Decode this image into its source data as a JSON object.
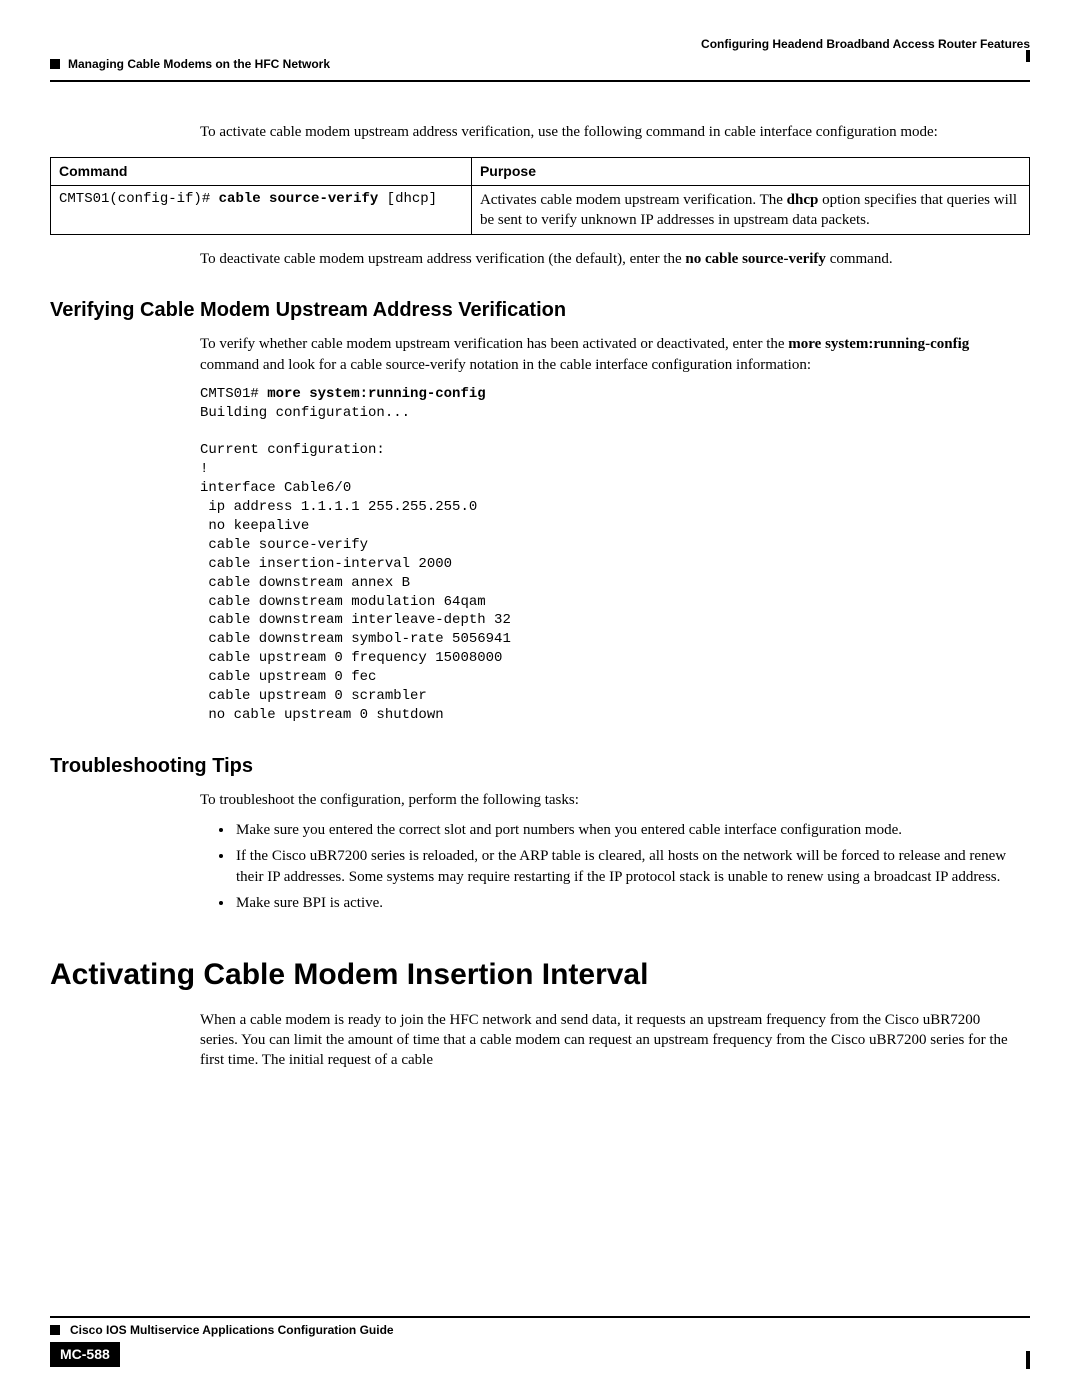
{
  "runningHeadRight": "Configuring Headend Broadband Access Router Features",
  "runningHeadLeft": "Managing Cable Modems on the HFC Network",
  "intro1": "To activate cable modem upstream address verification, use the following command in cable interface configuration mode:",
  "table": {
    "headers": {
      "command": "Command",
      "purpose": "Purpose"
    },
    "row1": {
      "prompt": "CMTS01(config-if)# ",
      "cmd": "cable source-verify ",
      "arg": "[dhcp]",
      "purpose_a": "Activates cable modem upstream verification. The ",
      "purpose_b": "dhcp",
      "purpose_c": " option specifies that queries will be sent to verify unknown IP addresses in upstream data packets."
    }
  },
  "intro2_a": "To deactivate cable modem upstream address verification (the default), enter the ",
  "intro2_b": "no cable source-verify",
  "intro2_c": " command.",
  "h2_verify": "Verifying Cable Modem Upstream Address Verification",
  "verify_a": "To verify whether cable modem upstream verification has been activated or deactivated, enter the  ",
  "verify_b": "more system:running-config",
  "verify_c": " command and look for a cable source-verify notation in the cable interface configuration information:",
  "code_prompt": "CMTS01# ",
  "code_cmd": "more system:running-config",
  "code_body": "Building configuration...\n\nCurrent configuration:\n!\ninterface Cable6/0\n ip address 1.1.1.1 255.255.255.0\n no keepalive\n cable source-verify\n cable insertion-interval 2000\n cable downstream annex B\n cable downstream modulation 64qam\n cable downstream interleave-depth 32\n cable downstream symbol-rate 5056941\n cable upstream 0 frequency 15008000\n cable upstream 0 fec\n cable upstream 0 scrambler\n no cable upstream 0 shutdown",
  "h2_trouble": "Troubleshooting Tips",
  "trouble_intro": "To troubleshoot the configuration, perform the following tasks:",
  "trouble_items": [
    "Make sure you entered the correct slot and port numbers when you entered cable interface configuration mode.",
    "If the Cisco uBR7200 series is reloaded, or the ARP table is cleared, all hosts on the network will be forced to release and renew their IP addresses. Some systems may require restarting if the IP protocol stack is unable to renew using a broadcast IP address.",
    "Make sure BPI is active."
  ],
  "h1_activating": "Activating Cable Modem Insertion Interval",
  "activating_p": "When a cable modem is ready to join the HFC network and send data, it requests an upstream frequency from the Cisco uBR7200 series. You can limit the amount of time that a cable modem can request an upstream frequency from the Cisco uBR7200 series for the first time. The initial request of a cable",
  "footerTitle": "Cisco IOS Multiservice Applications Configuration Guide",
  "pageNumber": "MC-588"
}
